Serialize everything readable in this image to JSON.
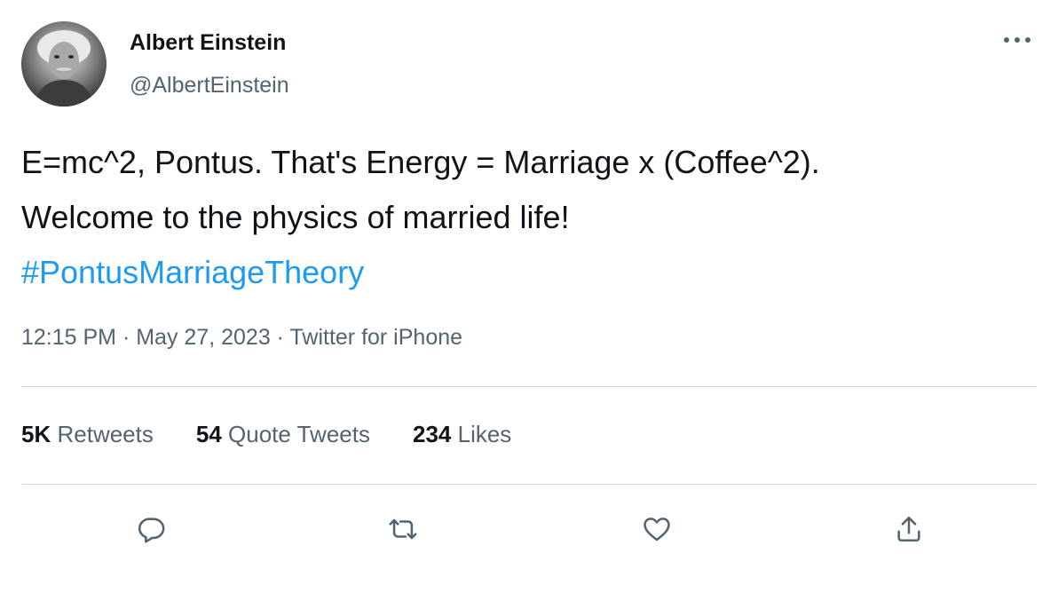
{
  "author": {
    "display_name": "Albert Einstein",
    "handle": "@AlbertEinstein",
    "avatar_icon": "profile-photo"
  },
  "tweet": {
    "text_line1": "E=mc^2, Pontus. That's Energy = Marriage x (Coffee^2).",
    "text_line2": "Welcome to the physics of married life!",
    "hashtag": "#PontusMarriageTheory"
  },
  "meta": {
    "time": "12:15 PM",
    "separator": " · ",
    "date": "May 27, 2023",
    "source": "Twitter for iPhone"
  },
  "stats": {
    "retweets_count": "5K",
    "retweets_label": "Retweets",
    "quotes_count": "54",
    "quotes_label": "Quote Tweets",
    "likes_count": "234",
    "likes_label": "Likes"
  },
  "icons": {
    "more": "more-horizontal-icon",
    "reply": "reply-icon",
    "retweet": "retweet-icon",
    "like": "heart-icon",
    "share": "share-icon"
  },
  "colors": {
    "text": "#0f1419",
    "secondary": "#536471",
    "link": "#1d9bf0",
    "divider": "#cfd9de"
  }
}
